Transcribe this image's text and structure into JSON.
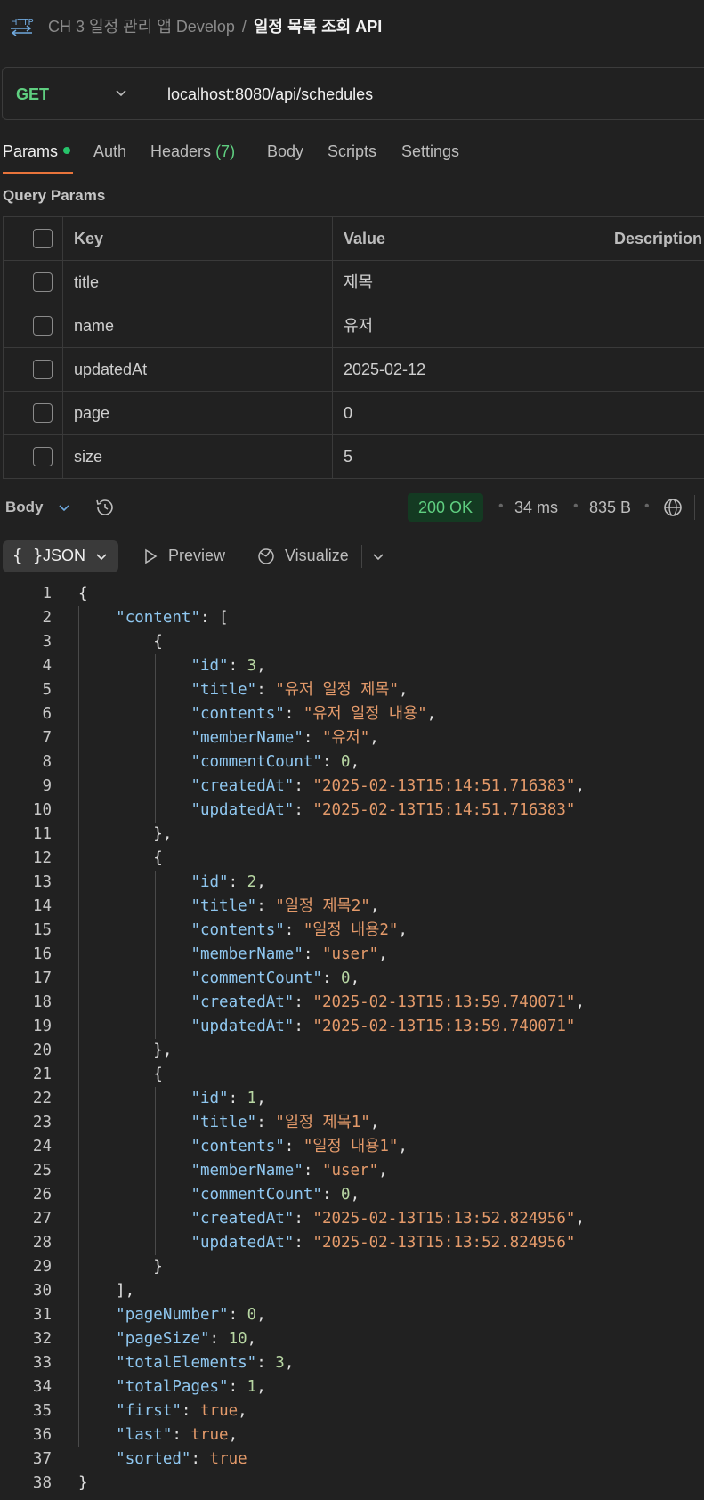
{
  "breadcrumb": {
    "collection": "CH 3 일정 관리 앱 Develop",
    "separator": "/",
    "request": "일정 목록 조회 API",
    "icon": "http-icon"
  },
  "request": {
    "method": "GET",
    "url": "localhost:8080/api/schedules"
  },
  "tabs": {
    "params": "Params",
    "auth": "Auth",
    "headers": "Headers",
    "headers_count": "(7)",
    "body": "Body",
    "scripts": "Scripts",
    "settings": "Settings"
  },
  "query_params": {
    "title": "Query Params",
    "headers": {
      "key": "Key",
      "value": "Value",
      "description": "Description"
    },
    "rows": [
      {
        "key": "title",
        "value": "제목"
      },
      {
        "key": "name",
        "value": "유저"
      },
      {
        "key": "updatedAt",
        "value": "2025-02-12"
      },
      {
        "key": "page",
        "value": "0"
      },
      {
        "key": "size",
        "value": "5"
      }
    ]
  },
  "response": {
    "label": "Body",
    "status": "200 OK",
    "time": "34 ms",
    "size": "835 B",
    "format": "JSON",
    "format_icon": "{ }",
    "preview": "Preview",
    "visualize": "Visualize"
  },
  "colors": {
    "accent": "#e8743b",
    "ok_green": "#5fcf80",
    "json_key": "#8fc7f0",
    "json_string": "#e49a6a",
    "json_number": "#b8d7a3"
  },
  "code_lines": [
    [
      [
        "p",
        "{"
      ]
    ],
    [
      [
        "p",
        "    "
      ],
      [
        "k",
        "\"content\""
      ],
      [
        "p",
        ": ["
      ]
    ],
    [
      [
        "p",
        "        {"
      ]
    ],
    [
      [
        "p",
        "            "
      ],
      [
        "k",
        "\"id\""
      ],
      [
        "p",
        ": "
      ],
      [
        "n",
        "3"
      ],
      [
        "p",
        ","
      ]
    ],
    [
      [
        "p",
        "            "
      ],
      [
        "k",
        "\"title\""
      ],
      [
        "p",
        ": "
      ],
      [
        "s",
        "\"유저 일정 제목\""
      ],
      [
        "p",
        ","
      ]
    ],
    [
      [
        "p",
        "            "
      ],
      [
        "k",
        "\"contents\""
      ],
      [
        "p",
        ": "
      ],
      [
        "s",
        "\"유저 일정 내용\""
      ],
      [
        "p",
        ","
      ]
    ],
    [
      [
        "p",
        "            "
      ],
      [
        "k",
        "\"memberName\""
      ],
      [
        "p",
        ": "
      ],
      [
        "s",
        "\"유저\""
      ],
      [
        "p",
        ","
      ]
    ],
    [
      [
        "p",
        "            "
      ],
      [
        "k",
        "\"commentCount\""
      ],
      [
        "p",
        ": "
      ],
      [
        "n",
        "0"
      ],
      [
        "p",
        ","
      ]
    ],
    [
      [
        "p",
        "            "
      ],
      [
        "k",
        "\"createdAt\""
      ],
      [
        "p",
        ": "
      ],
      [
        "s",
        "\"2025-02-13T15:14:51.716383\""
      ],
      [
        "p",
        ","
      ]
    ],
    [
      [
        "p",
        "            "
      ],
      [
        "k",
        "\"updatedAt\""
      ],
      [
        "p",
        ": "
      ],
      [
        "s",
        "\"2025-02-13T15:14:51.716383\""
      ]
    ],
    [
      [
        "p",
        "        },"
      ]
    ],
    [
      [
        "p",
        "        {"
      ]
    ],
    [
      [
        "p",
        "            "
      ],
      [
        "k",
        "\"id\""
      ],
      [
        "p",
        ": "
      ],
      [
        "n",
        "2"
      ],
      [
        "p",
        ","
      ]
    ],
    [
      [
        "p",
        "            "
      ],
      [
        "k",
        "\"title\""
      ],
      [
        "p",
        ": "
      ],
      [
        "s",
        "\"일정 제목2\""
      ],
      [
        "p",
        ","
      ]
    ],
    [
      [
        "p",
        "            "
      ],
      [
        "k",
        "\"contents\""
      ],
      [
        "p",
        ": "
      ],
      [
        "s",
        "\"일정 내용2\""
      ],
      [
        "p",
        ","
      ]
    ],
    [
      [
        "p",
        "            "
      ],
      [
        "k",
        "\"memberName\""
      ],
      [
        "p",
        ": "
      ],
      [
        "s",
        "\"user\""
      ],
      [
        "p",
        ","
      ]
    ],
    [
      [
        "p",
        "            "
      ],
      [
        "k",
        "\"commentCount\""
      ],
      [
        "p",
        ": "
      ],
      [
        "n",
        "0"
      ],
      [
        "p",
        ","
      ]
    ],
    [
      [
        "p",
        "            "
      ],
      [
        "k",
        "\"createdAt\""
      ],
      [
        "p",
        ": "
      ],
      [
        "s",
        "\"2025-02-13T15:13:59.740071\""
      ],
      [
        "p",
        ","
      ]
    ],
    [
      [
        "p",
        "            "
      ],
      [
        "k",
        "\"updatedAt\""
      ],
      [
        "p",
        ": "
      ],
      [
        "s",
        "\"2025-02-13T15:13:59.740071\""
      ]
    ],
    [
      [
        "p",
        "        },"
      ]
    ],
    [
      [
        "p",
        "        {"
      ]
    ],
    [
      [
        "p",
        "            "
      ],
      [
        "k",
        "\"id\""
      ],
      [
        "p",
        ": "
      ],
      [
        "n",
        "1"
      ],
      [
        "p",
        ","
      ]
    ],
    [
      [
        "p",
        "            "
      ],
      [
        "k",
        "\"title\""
      ],
      [
        "p",
        ": "
      ],
      [
        "s",
        "\"일정 제목1\""
      ],
      [
        "p",
        ","
      ]
    ],
    [
      [
        "p",
        "            "
      ],
      [
        "k",
        "\"contents\""
      ],
      [
        "p",
        ": "
      ],
      [
        "s",
        "\"일정 내용1\""
      ],
      [
        "p",
        ","
      ]
    ],
    [
      [
        "p",
        "            "
      ],
      [
        "k",
        "\"memberName\""
      ],
      [
        "p",
        ": "
      ],
      [
        "s",
        "\"user\""
      ],
      [
        "p",
        ","
      ]
    ],
    [
      [
        "p",
        "            "
      ],
      [
        "k",
        "\"commentCount\""
      ],
      [
        "p",
        ": "
      ],
      [
        "n",
        "0"
      ],
      [
        "p",
        ","
      ]
    ],
    [
      [
        "p",
        "            "
      ],
      [
        "k",
        "\"createdAt\""
      ],
      [
        "p",
        ": "
      ],
      [
        "s",
        "\"2025-02-13T15:13:52.824956\""
      ],
      [
        "p",
        ","
      ]
    ],
    [
      [
        "p",
        "            "
      ],
      [
        "k",
        "\"updatedAt\""
      ],
      [
        "p",
        ": "
      ],
      [
        "s",
        "\"2025-02-13T15:13:52.824956\""
      ]
    ],
    [
      [
        "p",
        "        }"
      ]
    ],
    [
      [
        "p",
        "    ],"
      ]
    ],
    [
      [
        "p",
        "    "
      ],
      [
        "k",
        "\"pageNumber\""
      ],
      [
        "p",
        ": "
      ],
      [
        "n",
        "0"
      ],
      [
        "p",
        ","
      ]
    ],
    [
      [
        "p",
        "    "
      ],
      [
        "k",
        "\"pageSize\""
      ],
      [
        "p",
        ": "
      ],
      [
        "n",
        "10"
      ],
      [
        "p",
        ","
      ]
    ],
    [
      [
        "p",
        "    "
      ],
      [
        "k",
        "\"totalElements\""
      ],
      [
        "p",
        ": "
      ],
      [
        "n",
        "3"
      ],
      [
        "p",
        ","
      ]
    ],
    [
      [
        "p",
        "    "
      ],
      [
        "k",
        "\"totalPages\""
      ],
      [
        "p",
        ": "
      ],
      [
        "n",
        "1"
      ],
      [
        "p",
        ","
      ]
    ],
    [
      [
        "p",
        "    "
      ],
      [
        "k",
        "\"first\""
      ],
      [
        "p",
        ": "
      ],
      [
        "b",
        "true"
      ],
      [
        "p",
        ","
      ]
    ],
    [
      [
        "p",
        "    "
      ],
      [
        "k",
        "\"last\""
      ],
      [
        "p",
        ": "
      ],
      [
        "b",
        "true"
      ],
      [
        "p",
        ","
      ]
    ],
    [
      [
        "p",
        "    "
      ],
      [
        "k",
        "\"sorted\""
      ],
      [
        "p",
        ": "
      ],
      [
        "b",
        "true"
      ]
    ],
    [
      [
        "p",
        "}"
      ]
    ]
  ]
}
